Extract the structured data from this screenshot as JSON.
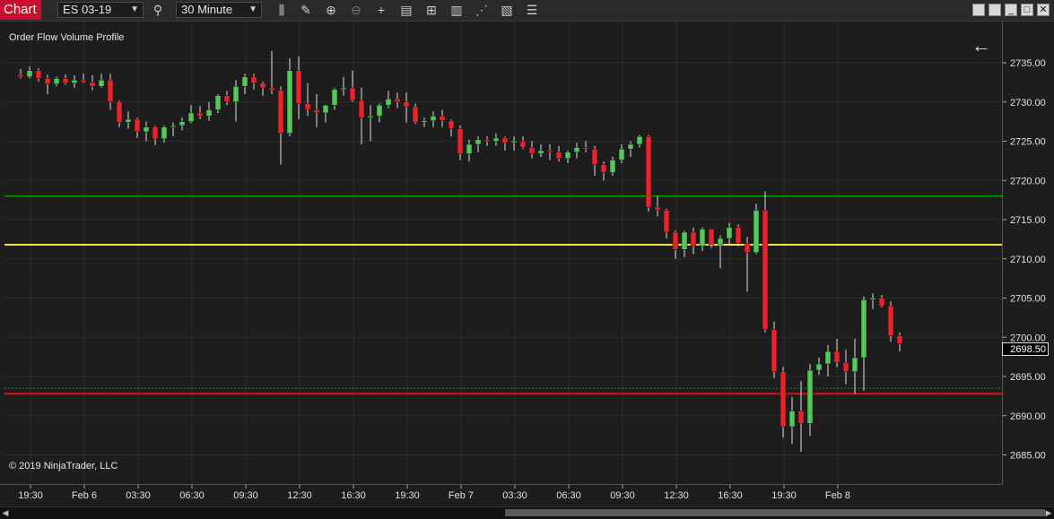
{
  "toolbar": {
    "chart_tab": "Chart",
    "instrument": "ES 03-19",
    "interval": "30 Minute"
  },
  "chart": {
    "indicator_label": "Order Flow Volume Profile",
    "copyright": "© 2019 NinjaTrader, LLC",
    "current_price_label": "2698.50",
    "colors": {
      "up": "#54c95a",
      "down": "#e8232e",
      "wick": "#e0e0e0",
      "green_line": "#00a000",
      "yellow_line": "#f5e74a",
      "red_line": "#e01010",
      "dotted_line": "#1f8a3a"
    }
  },
  "chart_data": {
    "type": "candlestick",
    "ylim": [
      2683,
      2738
    ],
    "price_ticks": [
      "2735.00",
      "2730.00",
      "2725.00",
      "2720.00",
      "2715.00",
      "2710.00",
      "2705.00",
      "2700.00",
      "2695.00",
      "2690.00",
      "2685.00"
    ],
    "time_ticks": [
      "19:30",
      "Feb 6",
      "03:30",
      "06:30",
      "09:30",
      "12:30",
      "16:30",
      "19:30",
      "Feb 7",
      "03:30",
      "06:30",
      "09:30",
      "12:30",
      "16:30",
      "19:30",
      "Feb 8"
    ],
    "horizontal_lines": [
      {
        "price": 2718.0,
        "color": "green"
      },
      {
        "price": 2711.8,
        "color": "yellow"
      },
      {
        "price": 2693.5,
        "color": "dotted-green"
      },
      {
        "price": 2692.8,
        "color": "red"
      }
    ],
    "candles": [
      [
        2733.5,
        2734.2,
        2733.0,
        2733.2
      ],
      [
        2733.2,
        2734.5,
        2733.0,
        2734.0
      ],
      [
        2734.0,
        2734.3,
        2732.6,
        2733.0
      ],
      [
        2733.0,
        2733.5,
        2731.0,
        2732.3
      ],
      [
        2732.3,
        2733.2,
        2732.0,
        2733.0
      ],
      [
        2733.0,
        2733.5,
        2732.2,
        2732.4
      ],
      [
        2732.4,
        2733.4,
        2731.8,
        2732.8
      ],
      [
        2732.8,
        2733.6,
        2732.4,
        2732.5
      ],
      [
        2732.5,
        2733.4,
        2731.5,
        2732.0
      ],
      [
        2732.0,
        2733.6,
        2731.8,
        2732.8
      ],
      [
        2732.8,
        2733.6,
        2729.0,
        2730.0
      ],
      [
        2730.0,
        2730.2,
        2726.8,
        2727.4
      ],
      [
        2727.4,
        2728.8,
        2726.6,
        2727.8
      ],
      [
        2727.8,
        2728.0,
        2725.4,
        2726.2
      ],
      [
        2726.2,
        2727.5,
        2725.0,
        2726.8
      ],
      [
        2726.8,
        2727.0,
        2724.5,
        2725.3
      ],
      [
        2725.3,
        2727.0,
        2724.8,
        2726.8
      ],
      [
        2726.8,
        2727.4,
        2725.6,
        2727.0
      ],
      [
        2727.0,
        2728.0,
        2726.4,
        2727.5
      ],
      [
        2727.5,
        2729.6,
        2727.3,
        2728.6
      ],
      [
        2728.6,
        2729.5,
        2727.8,
        2728.2
      ],
      [
        2728.2,
        2730.0,
        2727.6,
        2729.0
      ],
      [
        2729.0,
        2731.0,
        2728.6,
        2730.8
      ],
      [
        2730.8,
        2731.4,
        2729.6,
        2730.0
      ],
      [
        2730.0,
        2732.8,
        2727.5,
        2732.0
      ],
      [
        2732.0,
        2733.6,
        2731.0,
        2733.2
      ],
      [
        2733.2,
        2733.6,
        2731.6,
        2732.4
      ],
      [
        2732.4,
        2732.6,
        2730.8,
        2731.8
      ],
      [
        2731.8,
        2736.5,
        2731.0,
        2731.5
      ],
      [
        2731.5,
        2732.0,
        2722.0,
        2726.0
      ],
      [
        2726.0,
        2735.6,
        2725.6,
        2734.0
      ],
      [
        2734.0,
        2735.8,
        2727.8,
        2729.8
      ],
      [
        2729.8,
        2732.4,
        2728.2,
        2729.0
      ],
      [
        2729.0,
        2731.0,
        2726.8,
        2728.6
      ],
      [
        2728.6,
        2729.5,
        2727.4,
        2729.6
      ],
      [
        2729.6,
        2731.8,
        2729.0,
        2731.6
      ],
      [
        2731.6,
        2733.2,
        2730.8,
        2731.8
      ],
      [
        2731.8,
        2734.0,
        2730.0,
        2730.2
      ],
      [
        2730.2,
        2731.8,
        2724.6,
        2728.0
      ],
      [
        2728.0,
        2729.6,
        2725.0,
        2728.2
      ],
      [
        2728.2,
        2729.8,
        2727.4,
        2729.6
      ],
      [
        2729.6,
        2731.4,
        2729.2,
        2730.4
      ],
      [
        2730.4,
        2731.2,
        2729.2,
        2730.0
      ],
      [
        2730.0,
        2731.2,
        2727.4,
        2729.4
      ],
      [
        2729.4,
        2729.8,
        2727.2,
        2727.4
      ],
      [
        2727.4,
        2728.0,
        2726.8,
        2727.6
      ],
      [
        2727.6,
        2728.8,
        2726.8,
        2728.2
      ],
      [
        2728.2,
        2729.0,
        2726.8,
        2727.6
      ],
      [
        2727.6,
        2727.8,
        2725.6,
        2726.6
      ],
      [
        2726.6,
        2727.0,
        2722.6,
        2723.4
      ],
      [
        2723.4,
        2725.2,
        2722.4,
        2724.6
      ],
      [
        2724.6,
        2725.6,
        2723.6,
        2725.2
      ],
      [
        2725.2,
        2725.6,
        2724.4,
        2725.0
      ],
      [
        2725.0,
        2726.0,
        2724.4,
        2725.4
      ],
      [
        2725.4,
        2725.6,
        2723.8,
        2724.8
      ],
      [
        2724.8,
        2725.6,
        2723.8,
        2725.0
      ],
      [
        2725.0,
        2725.6,
        2724.0,
        2724.2
      ],
      [
        2724.2,
        2725.0,
        2722.8,
        2723.4
      ],
      [
        2723.4,
        2724.6,
        2723.0,
        2723.8
      ],
      [
        2723.8,
        2724.6,
        2722.6,
        2723.6
      ],
      [
        2723.6,
        2724.4,
        2722.4,
        2722.8
      ],
      [
        2722.8,
        2723.8,
        2722.2,
        2723.6
      ],
      [
        2723.6,
        2724.8,
        2722.8,
        2724.2
      ],
      [
        2724.2,
        2725.0,
        2723.6,
        2724.0
      ],
      [
        2724.0,
        2724.4,
        2720.6,
        2722.0
      ],
      [
        2722.0,
        2722.4,
        2720.0,
        2721.0
      ],
      [
        2721.0,
        2723.0,
        2720.6,
        2722.6
      ],
      [
        2722.6,
        2724.6,
        2722.2,
        2724.0
      ],
      [
        2724.0,
        2725.0,
        2723.0,
        2724.6
      ],
      [
        2724.6,
        2725.8,
        2724.2,
        2725.6
      ],
      [
        2725.6,
        2725.8,
        2716.0,
        2716.6
      ],
      [
        2716.6,
        2718.0,
        2715.4,
        2716.2
      ],
      [
        2716.2,
        2716.4,
        2712.6,
        2713.4
      ],
      [
        2713.4,
        2713.6,
        2710.0,
        2711.2
      ],
      [
        2711.2,
        2713.6,
        2710.2,
        2713.4
      ],
      [
        2713.4,
        2714.0,
        2710.6,
        2711.6
      ],
      [
        2711.6,
        2714.0,
        2711.0,
        2713.8
      ],
      [
        2713.8,
        2713.8,
        2711.4,
        2711.8
      ],
      [
        2711.8,
        2713.0,
        2708.8,
        2712.6
      ],
      [
        2712.6,
        2714.6,
        2711.8,
        2714.0
      ],
      [
        2714.0,
        2714.4,
        2711.6,
        2712.0
      ],
      [
        2712.0,
        2712.8,
        2705.8,
        2710.8
      ],
      [
        2710.8,
        2717.0,
        2710.6,
        2716.2
      ],
      [
        2716.2,
        2718.6,
        2700.6,
        2701.0
      ],
      [
        2701.0,
        2702.0,
        2694.8,
        2695.6
      ],
      [
        2695.6,
        2696.2,
        2687.2,
        2688.6
      ],
      [
        2688.6,
        2692.4,
        2686.4,
        2690.6
      ],
      [
        2690.6,
        2694.4,
        2685.4,
        2689.0
      ],
      [
        2689.0,
        2696.6,
        2687.4,
        2695.8
      ],
      [
        2695.8,
        2697.4,
        2695.2,
        2696.6
      ],
      [
        2696.6,
        2699.0,
        2695.0,
        2698.2
      ],
      [
        2698.2,
        2699.8,
        2696.2,
        2696.8
      ],
      [
        2696.8,
        2698.4,
        2694.0,
        2695.6
      ],
      [
        2695.6,
        2699.8,
        2692.8,
        2697.4
      ],
      [
        2697.4,
        2705.2,
        2693.2,
        2704.8
      ],
      [
        2704.8,
        2705.6,
        2703.6,
        2705.0
      ],
      [
        2705.0,
        2705.4,
        2703.8,
        2704.0
      ],
      [
        2704.0,
        2704.6,
        2699.4,
        2700.2
      ],
      [
        2700.2,
        2700.6,
        2698.2,
        2699.2
      ]
    ]
  }
}
